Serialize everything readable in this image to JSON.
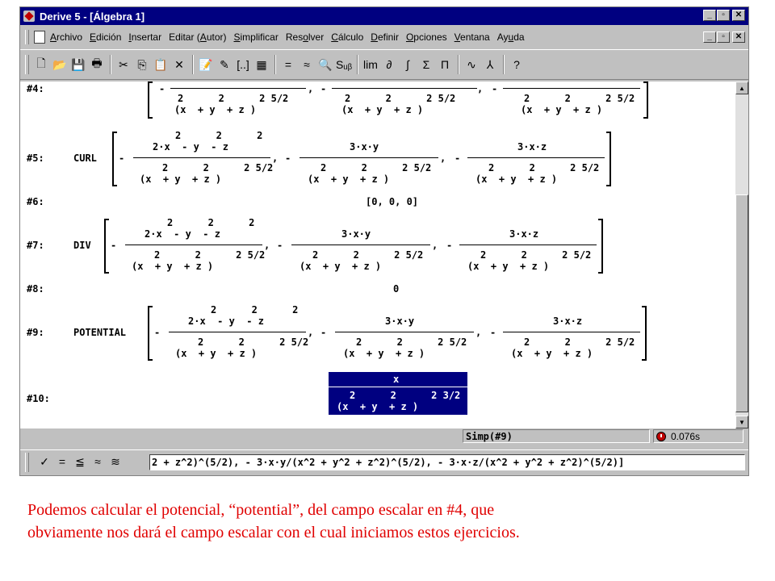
{
  "window": {
    "title": "Derive 5 - [Álgebra 1]"
  },
  "menu": [
    {
      "name": "archivo",
      "pre": "",
      "u": "A",
      "post": "rchivo"
    },
    {
      "name": "edicion",
      "pre": "",
      "u": "E",
      "post": "dición"
    },
    {
      "name": "insertar",
      "pre": "",
      "u": "I",
      "post": "nsertar"
    },
    {
      "name": "editar",
      "pre": "Editar (",
      "u": "A",
      "post": "utor)"
    },
    {
      "name": "simplificar",
      "pre": "",
      "u": "S",
      "post": "implificar"
    },
    {
      "name": "resolver",
      "pre": "Res",
      "u": "o",
      "post": "lver"
    },
    {
      "name": "calculo",
      "pre": "",
      "u": "C",
      "post": "álculo"
    },
    {
      "name": "definir",
      "pre": "",
      "u": "D",
      "post": "efinir"
    },
    {
      "name": "opciones",
      "pre": "",
      "u": "O",
      "post": "pciones"
    },
    {
      "name": "ventana",
      "pre": "",
      "u": "V",
      "post": "entana"
    },
    {
      "name": "ayuda",
      "pre": "Ay",
      "u": "u",
      "post": "da"
    }
  ],
  "toolbar": {
    "groups": [
      [
        {
          "name": "new-file-icon",
          "glyph": "🗋"
        },
        {
          "name": "open-folder-icon",
          "glyph": "📂"
        },
        {
          "name": "save-icon",
          "glyph": "💾"
        },
        {
          "name": "print-icon",
          "glyph": "🖶"
        }
      ],
      [
        {
          "name": "cut-icon",
          "glyph": "✂"
        },
        {
          "name": "copy-icon",
          "glyph": "⎘"
        },
        {
          "name": "paste-icon",
          "glyph": "📋"
        },
        {
          "name": "delete-icon",
          "glyph": "✕"
        }
      ],
      [
        {
          "name": "insert-text-icon",
          "glyph": "📝"
        },
        {
          "name": "edit-text-icon",
          "glyph": "✎"
        },
        {
          "name": "vector-icon",
          "glyph": "[..]"
        },
        {
          "name": "matrix-icon",
          "glyph": "▦"
        }
      ],
      [
        {
          "name": "simplify-icon",
          "glyph": "="
        },
        {
          "name": "approximate-icon",
          "glyph": "≈"
        },
        {
          "name": "zoom-expand-icon",
          "glyph": "🔍"
        },
        {
          "name": "substitute-icon",
          "glyph": "Sᵤᵦ"
        }
      ],
      [
        {
          "name": "limit-icon",
          "glyph": "lim"
        },
        {
          "name": "derivative-icon",
          "glyph": "∂"
        },
        {
          "name": "integral-icon",
          "glyph": "∫"
        },
        {
          "name": "sum-icon",
          "glyph": "Σ"
        },
        {
          "name": "product-icon",
          "glyph": "Π"
        }
      ],
      [
        {
          "name": "plot-2d-icon",
          "glyph": "∿"
        },
        {
          "name": "plot-3d-icon",
          "glyph": "⅄"
        }
      ],
      [
        {
          "name": "help-icon",
          "glyph": "?"
        }
      ]
    ]
  },
  "algebra": {
    "labels": {
      "e4": "#4:",
      "e5": "#5:",
      "e6": "#6:",
      "e7": "#7:",
      "e8": "#8:",
      "e9": "#9:",
      "e10": "#10:"
    },
    "fn": {
      "curl": "CURL",
      "div": "DIV",
      "potential": "POTENTIAL"
    },
    "e6_result": "[0, 0, 0]",
    "e8_result": "0",
    "minus": "-",
    "comma": ",",
    "exp_line": "2      2      2",
    "numA": "2·x  - y  - z",
    "numB": "3·x·y",
    "numC": "3·x·z",
    "den_exp": "2      2      2 5/2",
    "den_base": "(x  + y  + z )",
    "e10_num": "x",
    "e10_exp": "2      2      2 3/2",
    "e10_base": "(x  + y  + z )"
  },
  "status": {
    "message": "Simp(#9)",
    "time": "0.076s"
  },
  "entry": {
    "buttons": [
      {
        "name": "check-icon",
        "glyph": "✓"
      },
      {
        "name": "equals-icon",
        "glyph": "="
      },
      {
        "name": "simplify-enter-icon",
        "glyph": "≦"
      },
      {
        "name": "approx-icon",
        "glyph": "≈"
      },
      {
        "name": "approx-enter-icon",
        "glyph": "≋"
      }
    ],
    "value": "2 + z^2)^(5/2), - 3·x·y/(x^2 + y^2 + z^2)^(5/2), - 3·x·z/(x^2 + y^2 + z^2)^(5/2)]"
  },
  "caption": {
    "line1": "Podemos calcular el potencial, “potential”, del campo escalar en #4, que",
    "line2": "obviamente nos dará el campo escalar con el cual iniciamos estos ejercicios."
  }
}
